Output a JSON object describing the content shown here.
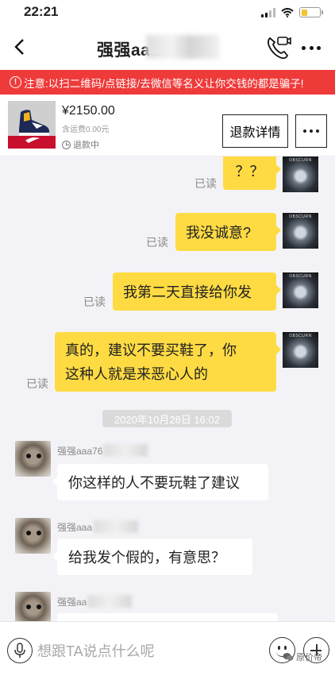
{
  "status_bar": {
    "time": "22:21"
  },
  "header": {
    "title": "强强aaa"
  },
  "warning": {
    "icon": "!",
    "text": "注意:以扫二维码/点链接/去微信等名义让你交钱的都是骗子!"
  },
  "product": {
    "price": "¥2150.00",
    "shipping": "含运费0.00元",
    "status": "退款中",
    "refund_button": "退款详情"
  },
  "messages": {
    "m1": {
      "text": "？？",
      "read": "已读"
    },
    "m2": {
      "text": "我没诚意?",
      "read": "已读"
    },
    "m3": {
      "text": "我第二天直接给你发",
      "read": "已读"
    },
    "m4": {
      "line1": "真的，建议不要买鞋了，你",
      "line2": "这种人就是来恶心人的",
      "read": "已读"
    },
    "timestamp": "2020年10月28日 16:02",
    "m5": {
      "sender": "强强aaa76",
      "text": "你这样的人不要玩鞋了建议"
    },
    "m6": {
      "sender": "强强aaa",
      "text": "给我发个假的，有意思？"
    },
    "m7": {
      "sender": "强强aa"
    }
  },
  "input": {
    "placeholder": "想跟TA说点什么呢"
  },
  "watermark": "原价帝",
  "avatar_brand": "OBSCURN"
}
